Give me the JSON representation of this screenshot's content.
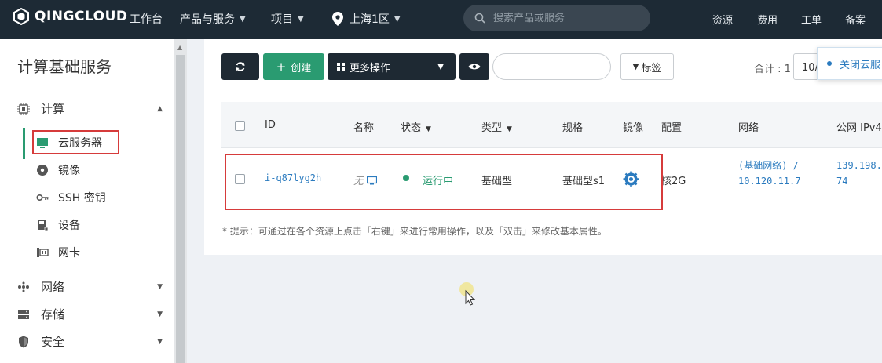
{
  "header": {
    "brand": "QINGCLOUD",
    "nav": [
      {
        "label": "工作台"
      },
      {
        "label": "产品与服务"
      },
      {
        "label": "项目"
      },
      {
        "label": "上海1区"
      }
    ],
    "search_placeholder": "搜索产品或服务",
    "right_links": [
      "资源",
      "费用",
      "工单",
      "备案"
    ]
  },
  "sidebar": {
    "title": "计算基础服务",
    "groups": {
      "compute": "计算",
      "network": "网络",
      "storage": "存储",
      "security": "安全"
    },
    "compute_items": [
      "云服务器",
      "镜像",
      "SSH 密钥",
      "设备",
      "网卡"
    ]
  },
  "toolbar": {
    "create": "创建",
    "more_actions": "更多操作",
    "tags": "标签",
    "total": "合计 : 1",
    "page_size": "10/",
    "popover": "关闭云服"
  },
  "table": {
    "columns": {
      "id": "ID",
      "name": "名称",
      "status": "状态",
      "type": "类型",
      "spec": "规格",
      "image": "镜像",
      "config": "配置",
      "network": "网络",
      "ipv4": "公网 IPv4"
    },
    "rows": [
      {
        "id": "i-q87lyg2h",
        "name": "无",
        "status": "运行中",
        "type": "基础型",
        "spec": "基础型s1",
        "config": "核2G",
        "network_name": "(基础网络) /",
        "network_ip": "10.120.11.7",
        "ipv4_line1": "139.198.",
        "ipv4_line2": "74"
      }
    ]
  },
  "hint": "* 提示：可通过在各个资源上点击「右键」来进行常用操作，以及「双击」来修改基本属性。",
  "colors": {
    "topbar": "#1d2a35",
    "accent_green": "#2a9b71",
    "link_blue": "#2b7bbf",
    "highlight_red": "#d63b3b"
  }
}
